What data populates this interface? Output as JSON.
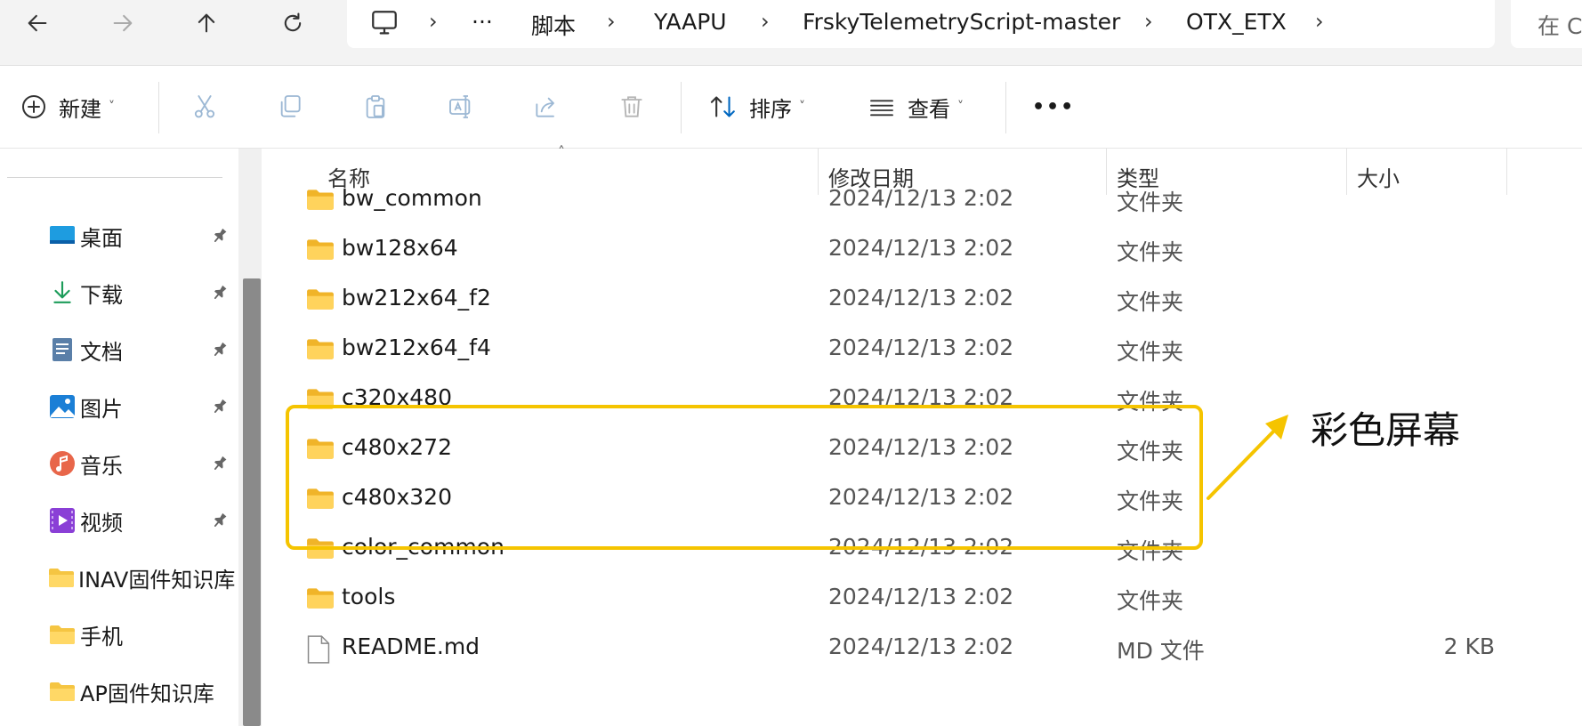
{
  "nav": {
    "back_icon": "arrow-left-icon",
    "forward_icon": "arrow-right-icon",
    "up_icon": "arrow-up-icon",
    "refresh_icon": "refresh-icon"
  },
  "breadcrumb": {
    "root_icon": "computer-icon",
    "overflow": "···",
    "items": [
      "脚本",
      "YAAPU",
      "FrskyTelemetryScript-master",
      "OTX_ETX"
    ],
    "separator": "›"
  },
  "search": {
    "placeholder": "在 C"
  },
  "toolbar": {
    "new_label": "新建",
    "sort_label": "排序",
    "view_label": "查看",
    "more": "•••"
  },
  "sidebar": {
    "items": [
      {
        "label": "桌面",
        "icon": "desktop-icon",
        "pinned": true
      },
      {
        "label": "下载",
        "icon": "download-icon",
        "pinned": true
      },
      {
        "label": "文档",
        "icon": "document-icon",
        "pinned": true
      },
      {
        "label": "图片",
        "icon": "picture-icon",
        "pinned": true
      },
      {
        "label": "音乐",
        "icon": "music-icon",
        "pinned": true
      },
      {
        "label": "视频",
        "icon": "video-icon",
        "pinned": true
      },
      {
        "label": "INAV固件知识库",
        "icon": "folder-icon",
        "pinned": false
      },
      {
        "label": "手机",
        "icon": "folder-icon",
        "pinned": false
      },
      {
        "label": "AP固件知识库",
        "icon": "folder-icon",
        "pinned": false
      }
    ]
  },
  "columns": {
    "name": "名称",
    "date": "修改日期",
    "type": "类型",
    "size": "大小"
  },
  "files": [
    {
      "name": "bw_common",
      "date": "2024/12/13 2:02",
      "type": "文件夹",
      "size": "",
      "icon": "folder-icon"
    },
    {
      "name": "bw128x64",
      "date": "2024/12/13 2:02",
      "type": "文件夹",
      "size": "",
      "icon": "folder-icon"
    },
    {
      "name": "bw212x64_f2",
      "date": "2024/12/13 2:02",
      "type": "文件夹",
      "size": "",
      "icon": "folder-icon"
    },
    {
      "name": "bw212x64_f4",
      "date": "2024/12/13 2:02",
      "type": "文件夹",
      "size": "",
      "icon": "folder-icon"
    },
    {
      "name": "c320x480",
      "date": "2024/12/13 2:02",
      "type": "文件夹",
      "size": "",
      "icon": "folder-icon"
    },
    {
      "name": "c480x272",
      "date": "2024/12/13 2:02",
      "type": "文件夹",
      "size": "",
      "icon": "folder-icon"
    },
    {
      "name": "c480x320",
      "date": "2024/12/13 2:02",
      "type": "文件夹",
      "size": "",
      "icon": "folder-icon"
    },
    {
      "name": "color_common",
      "date": "2024/12/13 2:02",
      "type": "文件夹",
      "size": "",
      "icon": "folder-icon"
    },
    {
      "name": "tools",
      "date": "2024/12/13 2:02",
      "type": "文件夹",
      "size": "",
      "icon": "folder-icon"
    },
    {
      "name": "README.md",
      "date": "2024/12/13 2:02",
      "type": "MD 文件",
      "size": "2 KB",
      "icon": "file-icon"
    }
  ],
  "annotation": {
    "text": "彩色屏幕",
    "color": "#f5c400"
  },
  "colors": {
    "folder": "#f5c542",
    "accent": "#0067c0",
    "highlight": "#f5c400"
  }
}
